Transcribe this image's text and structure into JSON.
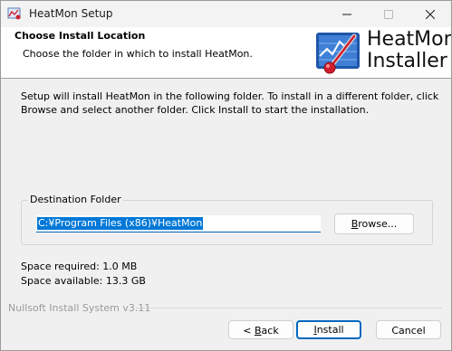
{
  "window": {
    "title": "HeatMon Setup"
  },
  "header": {
    "title": "Choose Install Location",
    "subtitle": "Choose the folder in which to install HeatMon.",
    "logo_line1": "HeatMon",
    "logo_line2": "Installer"
  },
  "intro_text": "Setup will install HeatMon in the following folder. To install in a different folder, click Browse and select another folder. Click Install to start the installation.",
  "destination": {
    "group_label": "Destination Folder",
    "path": "C:¥Program Files (x86)¥HeatMon",
    "browse_label_pre": "",
    "browse_label_mnemonic": "B",
    "browse_label_post": "rowse..."
  },
  "space": {
    "required": "Space required: 1.0 MB",
    "available": "Space available: 13.3 GB"
  },
  "footer": {
    "nsis_label": "Nullsoft Install System v3.11",
    "back_pre": "< ",
    "back_mnemonic": "B",
    "back_post": "ack",
    "install_mnemonic": "I",
    "install_post": "nstall",
    "cancel_label": "Cancel"
  },
  "colors": {
    "accent": "#0067c0",
    "selection": "#0078d7"
  }
}
